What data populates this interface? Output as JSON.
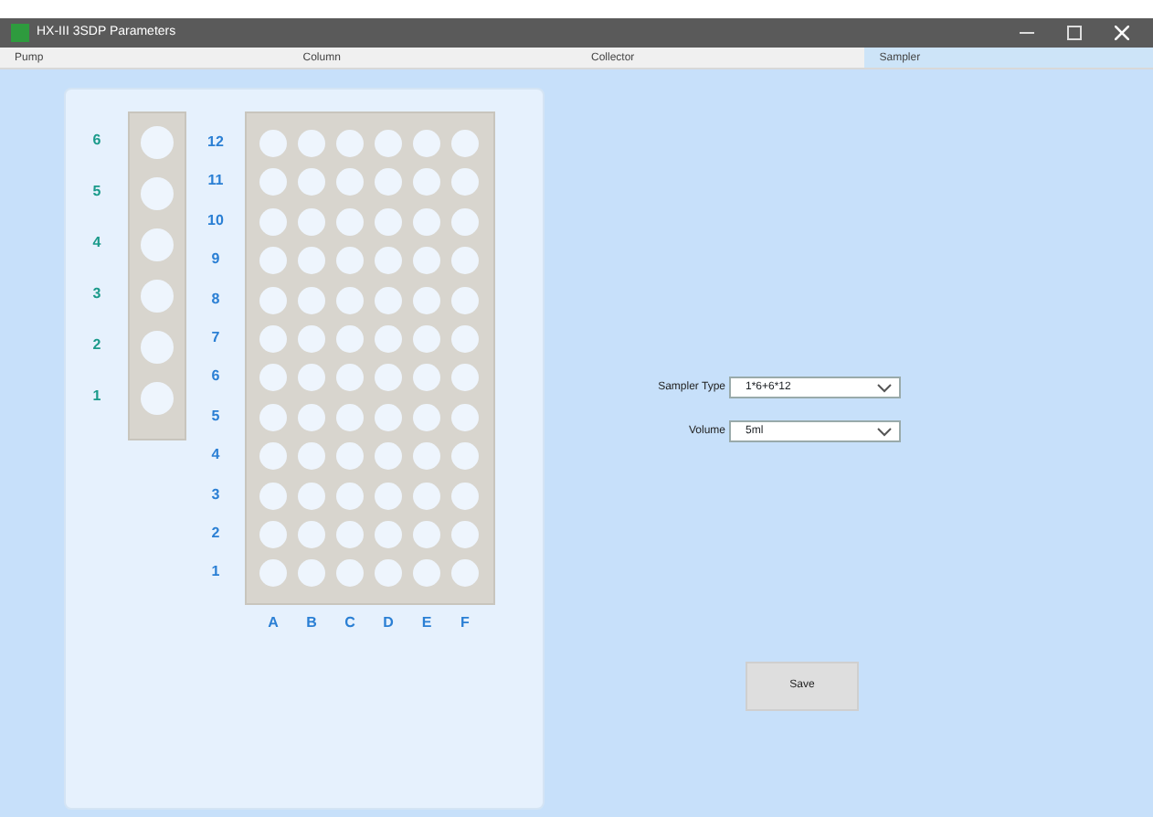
{
  "window": {
    "title": "HX-III 3SDP Parameters"
  },
  "tabs": [
    {
      "label": "Pump",
      "selected": false
    },
    {
      "label": "Column",
      "selected": false
    },
    {
      "label": "Collector",
      "selected": false
    },
    {
      "label": "Sampler",
      "selected": true
    }
  ],
  "tube_rack": {
    "position_labels": [
      "6",
      "5",
      "4",
      "3",
      "2",
      "1"
    ]
  },
  "plate": {
    "row_labels": [
      "12",
      "11",
      "10",
      "9",
      "8",
      "7",
      "6",
      "5",
      "4",
      "3",
      "2",
      "1"
    ],
    "column_labels": [
      "A",
      "B",
      "C",
      "D",
      "E",
      "F"
    ]
  },
  "form": {
    "fields": [
      {
        "label": "Sampler Type",
        "value": "1*6+6*12"
      },
      {
        "label": "Volume",
        "value": "5ml"
      }
    ],
    "save_button": "Save"
  }
}
